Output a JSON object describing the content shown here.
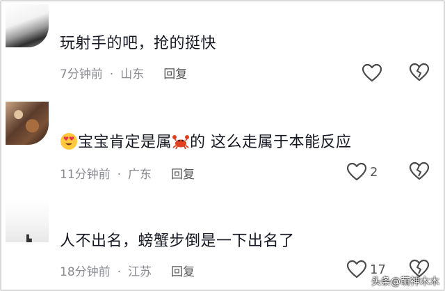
{
  "comments": [
    {
      "text": "玩射手的吧，抢的挺快",
      "time": "7分钟前",
      "location": "山东",
      "reply_label": "回复",
      "like_count": ""
    },
    {
      "text_before": "宝宝肯定是属",
      "text_after": "的 这么走属于本能反应",
      "time": "11分钟前",
      "location": "广东",
      "reply_label": "回复",
      "like_count": "2",
      "emojis": [
        "heart-eyes-emoji",
        "crab-emoji"
      ]
    },
    {
      "text": "人不出名，螃蟹步倒是一下出名了",
      "time": "18分钟前",
      "location": "江苏",
      "reply_label": "回复",
      "like_count": "17"
    }
  ],
  "separator": "·",
  "watermark": "头条@萌神木木",
  "icons": [
    "heart-outline-icon",
    "broken-heart-icon"
  ],
  "colors": {
    "text": "#161823",
    "meta": "#8a8b91",
    "crab": "#e0401e",
    "face": "#ffc83d",
    "heart": "#e8334a"
  }
}
